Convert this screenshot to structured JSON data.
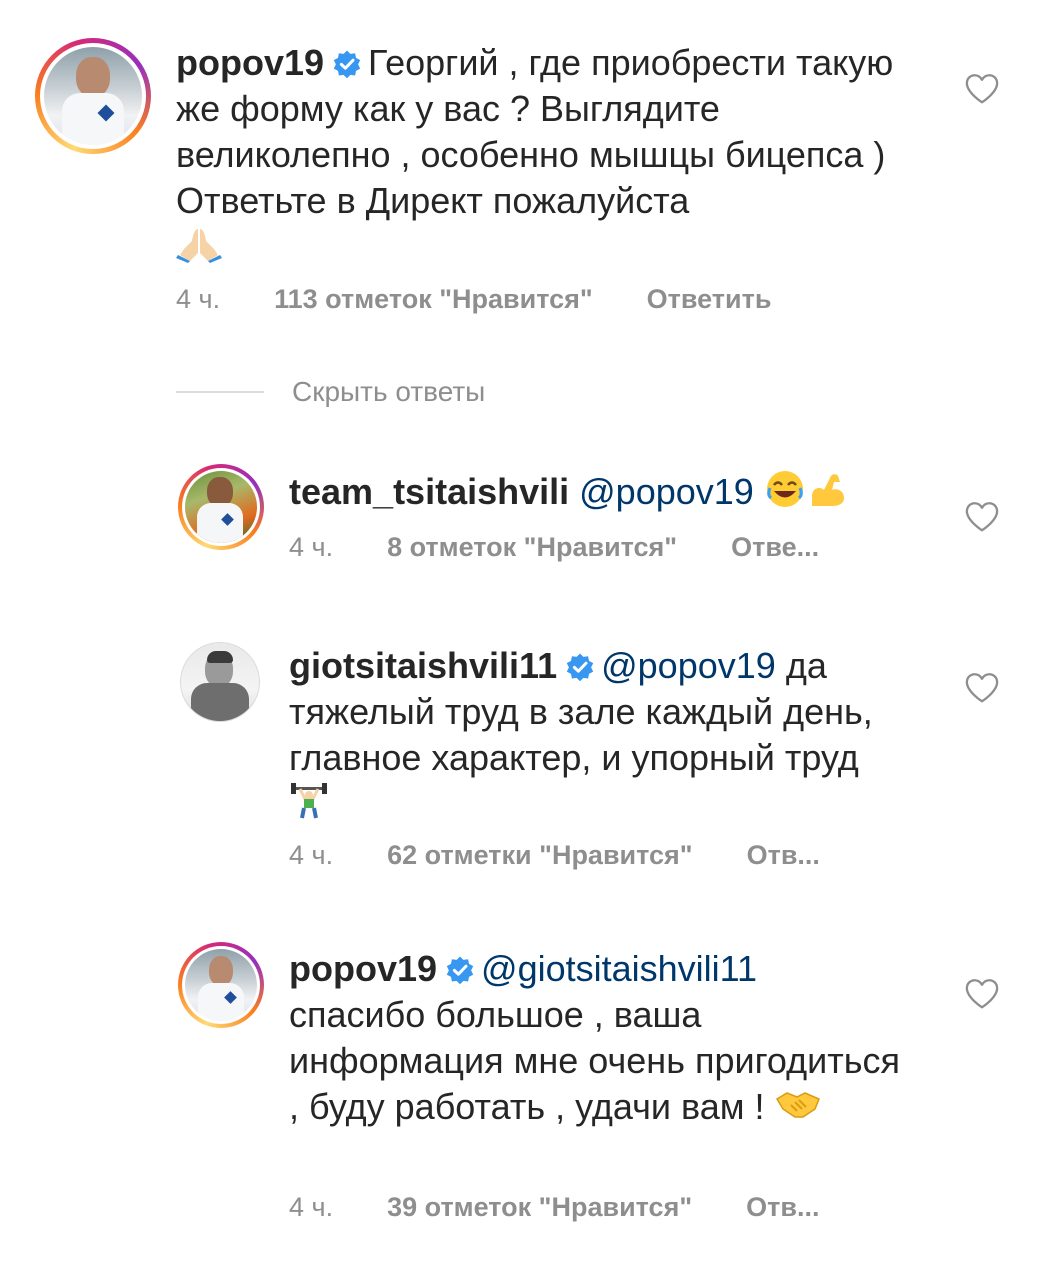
{
  "comments": [
    {
      "username": "popov19",
      "verified": true,
      "mention": "",
      "text": "Георгий , где приобрести такую же форму как у вас ? Выглядите великолепно , особенно мышцы бицепса ) Ответьте в Директ пожалуйста",
      "emoji": "folded-hands",
      "time": "4 ч.",
      "likes": "113 отметок \"Нравится\"",
      "reply": "Ответить"
    },
    {
      "username": "team_tsitaishvili",
      "verified": false,
      "mention": "@popov19",
      "text": "",
      "emoji": "laughing-flexed-biceps",
      "time": "4 ч.",
      "likes": "8 отметок \"Нравится\"",
      "reply": "Отве..."
    },
    {
      "username": "giotsitaishvili11",
      "verified": true,
      "mention": "@popov19",
      "text": "да тяжелый труд в зале каждый день, главное характер, и упорный труд",
      "emoji": "weightlifter",
      "time": "4 ч.",
      "likes": "62 отметки \"Нравится\"",
      "reply": "Отв..."
    },
    {
      "username": "popov19",
      "verified": true,
      "mention": "@giotsitaishvili11",
      "text": "спасибо большое , ваша информация мне очень пригодиться , буду работать , удачи вам !",
      "emoji": "handshake",
      "time": "4 ч.",
      "likes": "39 отметок \"Нравится\"",
      "reply": "Отв..."
    }
  ],
  "hide_replies": "Скрыть ответы",
  "colors": {
    "verified": "#3897f0",
    "mention": "#00376b",
    "meta": "#8e8e8e",
    "text": "#262626"
  }
}
